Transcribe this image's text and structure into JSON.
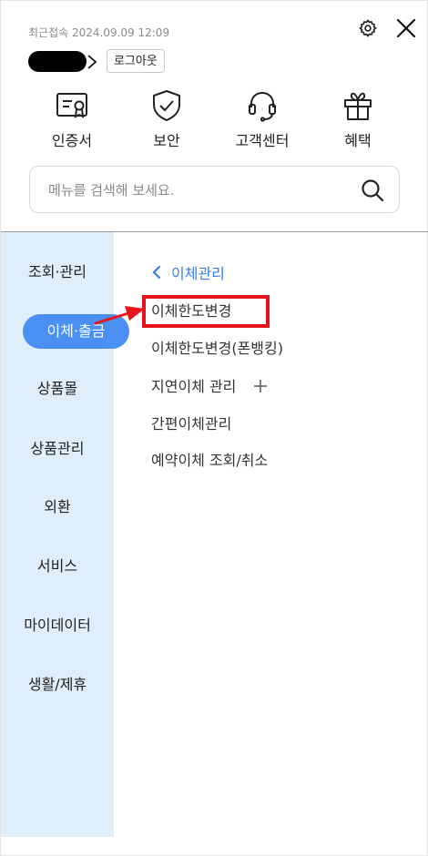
{
  "header": {
    "last_login": "최근접속 2024.09.09 12:09",
    "logout_label": "로그아웃"
  },
  "quick_menu": [
    {
      "label": "인증서",
      "icon": "certificate-icon"
    },
    {
      "label": "보안",
      "icon": "shield-check-icon"
    },
    {
      "label": "고객센터",
      "icon": "headset-icon"
    },
    {
      "label": "혜택",
      "icon": "gift-icon"
    }
  ],
  "search": {
    "placeholder": "메뉴를 검색해 보세요."
  },
  "sidebar": {
    "items": [
      {
        "label": "조회·관리"
      },
      {
        "label": "이체·출금",
        "active": true
      },
      {
        "label": "상품몰"
      },
      {
        "label": "상품관리"
      },
      {
        "label": "외환"
      },
      {
        "label": "서비스"
      },
      {
        "label": "마이데이터"
      },
      {
        "label": "생활/제휴"
      }
    ]
  },
  "submenu": {
    "title": "이체관리",
    "items": [
      {
        "label": "이체한도변경",
        "highlighted": true
      },
      {
        "label": "이체한도변경(폰뱅킹)"
      },
      {
        "label": "지연이체 관리",
        "expandable": true
      },
      {
        "label": "간편이체관리"
      },
      {
        "label": "예약이체 조회/취소"
      }
    ]
  },
  "colors": {
    "accent": "#4a90f2",
    "sidebar_bg": "#deeffb",
    "link": "#3a7ee6",
    "highlight": "#e8141b"
  }
}
